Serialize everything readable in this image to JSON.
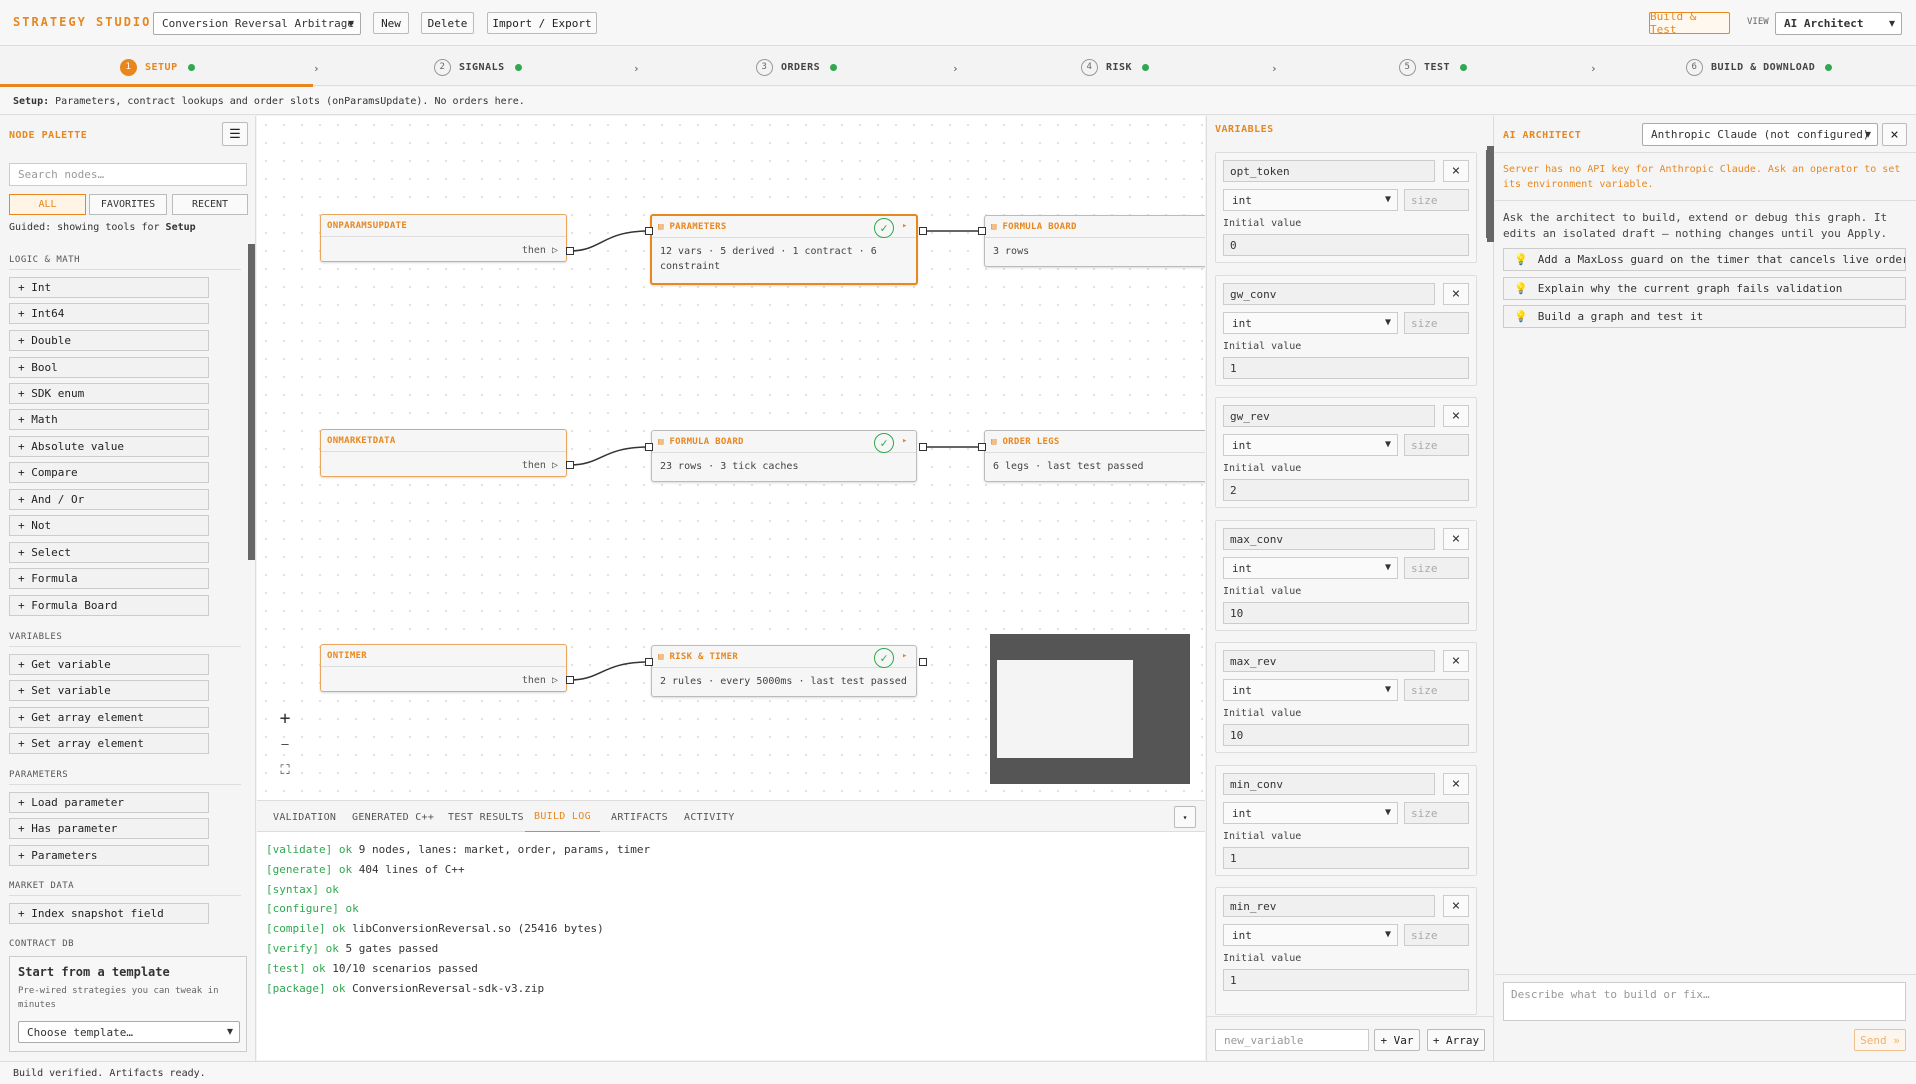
{
  "app": {
    "brand": "STRATEGY STUDIO",
    "strategy": "Conversion Reversal Arbitrage",
    "new": "New",
    "delete": "Delete",
    "import_export": "Import / Export",
    "build_test": "Build & Test",
    "view_label": "VIEW",
    "view_value": "AI Architect"
  },
  "steps": [
    {
      "num": "1",
      "label": "SETUP"
    },
    {
      "num": "2",
      "label": "SIGNALS"
    },
    {
      "num": "3",
      "label": "ORDERS"
    },
    {
      "num": "4",
      "label": "RISK"
    },
    {
      "num": "5",
      "label": "TEST"
    },
    {
      "num": "6",
      "label": "BUILD & DOWNLOAD"
    }
  ],
  "step_arrow": "›",
  "info": {
    "label": "Setup:",
    "text": "Parameters, contract lookups and order slots (onParamsUpdate). No orders here."
  },
  "palette": {
    "title": "NODE PALETTE",
    "menu_icon": "☰",
    "search_placeholder": "Search nodes…",
    "filters": [
      "ALL",
      "FAVORITES",
      "RECENT"
    ],
    "guided_prefix": "Guided: showing tools for",
    "guided_step": "Setup",
    "categories": [
      {
        "name": "LOGIC & MATH",
        "items": [
          "+ Int",
          "+ Int64",
          "+ Double",
          "+ Bool",
          "+ SDK enum",
          "+ Math",
          "+ Absolute value",
          "+ Compare",
          "+ And / Or",
          "+ Not",
          "+ Select",
          "+ Formula",
          "+ Formula Board"
        ]
      },
      {
        "name": "VARIABLES",
        "items": [
          "+ Get variable",
          "+ Set variable",
          "+ Get array element",
          "+ Set array element"
        ]
      },
      {
        "name": "PARAMETERS",
        "items": [
          "+ Load parameter",
          "+ Has parameter",
          "+ Parameters"
        ]
      },
      {
        "name": "MARKET DATA",
        "items": [
          "+ Index snapshot field"
        ]
      },
      {
        "name": "CONTRACT DB",
        "items": []
      }
    ],
    "template": {
      "title": "Start from a template",
      "desc": "Pre-wired strategies you can tweak in minutes",
      "select": "Choose template…"
    }
  },
  "graph": {
    "lanes": [
      {
        "event": "ONPARAMSUPDATE",
        "then": "then ▷",
        "node": {
          "title": "PARAMETERS",
          "body": "12 vars · 5 derived · 1 contract · 6 constraint"
        },
        "next": {
          "title": "FORMULA BOARD",
          "body": "3 rows"
        }
      },
      {
        "event": "ONMARKETDATA",
        "then": "then ▷",
        "node": {
          "title": "FORMULA BOARD",
          "body": "23 rows · 3 tick caches"
        },
        "next": {
          "title": "ORDER LEGS",
          "body": "6 legs · last test passed"
        }
      },
      {
        "event": "ONTIMER",
        "then": "then ▷",
        "node": {
          "title": "RISK & TIMER",
          "body": "2 rules · every 5000ms · last test passed"
        }
      }
    ],
    "node_icon": "▤",
    "check": "✓",
    "out_arrow": "▸",
    "zoom_in": "+",
    "zoom_out": "—",
    "fit": "⛶"
  },
  "bottom": {
    "tabs": [
      "VALIDATION",
      "GENERATED C++",
      "TEST RESULTS",
      "BUILD LOG",
      "ARTIFACTS",
      "ACTIVITY"
    ],
    "collapse": "▾",
    "log": [
      {
        "k": "[validate] ok",
        "t": " 9 nodes, lanes: market, order, params, timer"
      },
      {
        "k": "[generate] ok",
        "t": " 404 lines of C++"
      },
      {
        "k": "[syntax] ok",
        "t": ""
      },
      {
        "k": "[configure] ok",
        "t": ""
      },
      {
        "k": "[compile] ok",
        "t": " libConversionReversal.so (25416 bytes)"
      },
      {
        "k": "[verify] ok",
        "t": " 5 gates passed"
      },
      {
        "k": "[test] ok",
        "t": " 10/10 scenarios passed"
      },
      {
        "k": "[package] ok",
        "t": " ConversionReversal-sdk-v3.zip"
      }
    ]
  },
  "variables": {
    "title": "VARIABLES",
    "initial_label": "Initial value",
    "size_placeholder": "size",
    "items": [
      {
        "name": "opt_token",
        "type": "int",
        "value": "0"
      },
      {
        "name": "gw_conv",
        "type": "int",
        "value": "1"
      },
      {
        "name": "gw_rev",
        "type": "int",
        "value": "2"
      },
      {
        "name": "max_conv",
        "type": "int",
        "value": "10"
      },
      {
        "name": "max_rev",
        "type": "int",
        "value": "10"
      },
      {
        "name": "min_conv",
        "type": "int",
        "value": "1"
      },
      {
        "name": "min_rev",
        "type": "int",
        "value": "1"
      }
    ],
    "new_placeholder": "new_variable",
    "add_var": "+ Var",
    "add_array": "+ Array"
  },
  "ai": {
    "title": "AI ARCHITECT",
    "provider": "Anthropic Claude (not configured)",
    "warning": "Server has no API key for Anthropic Claude. Ask an operator to set its environment variable.",
    "intro": "Ask the architect to build, extend or debug this graph. It edits an isolated draft — nothing changes until you Apply.",
    "suggestions": [
      "Add a MaxLoss guard on the timer that cancels live orders a…",
      "Explain why the current graph fails validation",
      "Build a graph and test it"
    ],
    "bulb": "💡",
    "input_placeholder": "Describe what to build or fix…",
    "send": "Send »"
  },
  "status": "Build verified. Artifacts ready.",
  "colors": {
    "accent": "#e8871e",
    "ok": "#2fa84f"
  }
}
